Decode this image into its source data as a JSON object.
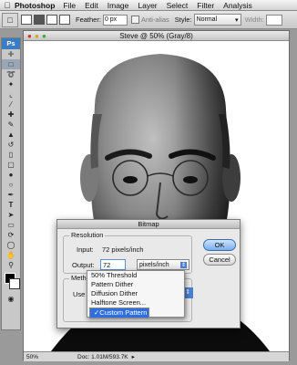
{
  "menubar": {
    "app": "Photoshop",
    "items": [
      "File",
      "Edit",
      "Image",
      "Layer",
      "Select",
      "Filter",
      "Analysis"
    ]
  },
  "options": {
    "feather_label": "Feather:",
    "feather_value": "0 px",
    "antialias_label": "Anti-alias",
    "style_label": "Style:",
    "style_value": "Normal",
    "width_label": "Width:"
  },
  "document": {
    "title": "Steve @ 50% (Gray/8)",
    "zoom": "50%",
    "doc_info": "Doc: 1.01M/593.7K"
  },
  "toolbar": {
    "ps_label": "Ps"
  },
  "dialog": {
    "title": "Bitmap",
    "resolution_legend": "Resolution",
    "input_label": "Input:",
    "input_value": "72 pixels/inch",
    "output_label": "Output:",
    "output_value": "72",
    "output_unit": "pixels/inch",
    "method_legend": "Meth",
    "use_label": "Use",
    "ok_label": "OK",
    "cancel_label": "Cancel"
  },
  "popup": {
    "items": [
      "50% Threshold",
      "Pattern Dither",
      "Diffusion Dither",
      "Halftone Screen...",
      "Custom Pattern"
    ],
    "selected_index": 4
  },
  "colors": {
    "selection": "#2f6ede",
    "ps_blue": "#3b7dc3"
  }
}
